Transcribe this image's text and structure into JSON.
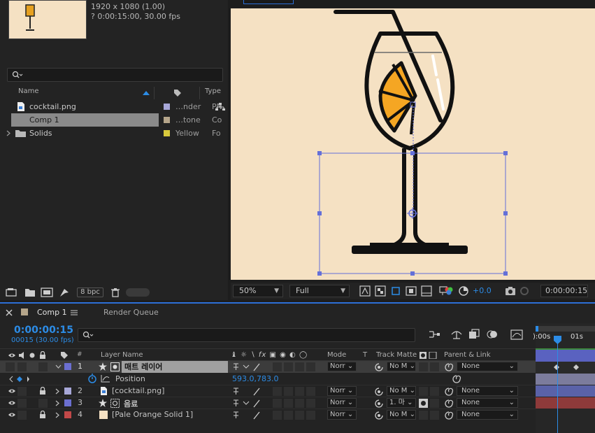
{
  "project": {
    "info_line1": "1920 x 1080 (1.00)",
    "info_line2": "? 0:00:15:00, 30.00 fps",
    "columns": {
      "name": "Name",
      "type": "Type"
    },
    "items": [
      {
        "name": "cocktail.png",
        "label": "…nder",
        "type": "PN",
        "tag_color": "#a7a7d8"
      },
      {
        "name": "Comp 1",
        "label": "…tone",
        "type": "Co",
        "tag_color": "#b5a58a",
        "selected": true
      },
      {
        "name": "Solids",
        "label": "Yellow",
        "type": "Fo",
        "tag_color": "#d8c93c"
      }
    ],
    "bpc": "8 bpc"
  },
  "viewer": {
    "zoom": "50%",
    "resolution": "Full",
    "exposure": "+0.0",
    "timecode": "0:00:00:15"
  },
  "timeline": {
    "tab_comp": "Comp 1",
    "tab_render": "Render Queue",
    "timecode": "0:00:00:15",
    "frame_info": "00015 (30.00 fps)",
    "headers": {
      "layer_name": "Layer Name",
      "mode": "Mode",
      "t": "T",
      "track_matte": "Track Matte",
      "parent": "Parent & Link"
    },
    "ruler": [
      "):00s",
      "01s"
    ],
    "position_prop": {
      "name": "Position",
      "value_x": "593.0",
      "value_y": "783.0",
      "sep": ","
    },
    "layers": [
      {
        "num": "1",
        "name": "매트 레이어",
        "mode": "Norr",
        "matte": "No M",
        "parent": "None",
        "color": "#6b6fd0",
        "selected": true,
        "lock": false
      },
      {
        "num": "2",
        "name": "[cocktail.png]",
        "mode": "Norr",
        "matte": "No M",
        "parent": "None",
        "color": "#a7a7d8",
        "lock": true
      },
      {
        "num": "3",
        "name": "음료",
        "mode": "Norr",
        "matte": "1. 마",
        "parent": "None",
        "color": "#6b6fd0",
        "lock": false
      },
      {
        "num": "4",
        "name": "[Pale Orange Solid 1]",
        "mode": "Norr",
        "matte": "No M",
        "parent": "None",
        "color": "#c24848",
        "lock": true
      }
    ],
    "bar_colors": [
      "#5a62c0",
      "#7c7c9c",
      "#5a62a8",
      "#8e3a3a"
    ]
  },
  "colors": {
    "accent": "#2c8ce6",
    "canvas_bg": "#f5e1c3",
    "orange": "#f5a623"
  }
}
